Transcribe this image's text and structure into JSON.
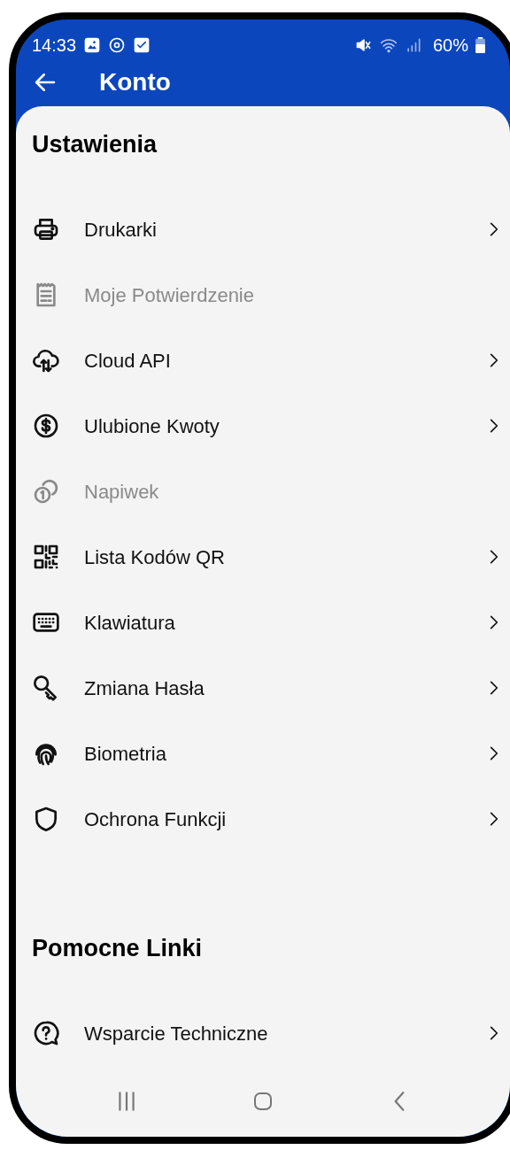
{
  "status_bar": {
    "time": "14:33",
    "battery": "60%"
  },
  "app_bar": {
    "title": "Konto"
  },
  "sections": [
    {
      "title": "Ustawienia",
      "items": [
        {
          "label": "Drukarki",
          "disabled": false
        },
        {
          "label": "Moje Potwierdzenie",
          "disabled": true
        },
        {
          "label": "Cloud API",
          "disabled": false
        },
        {
          "label": "Ulubione Kwoty",
          "disabled": false
        },
        {
          "label": "Napiwek",
          "disabled": true
        },
        {
          "label": "Lista Kodów QR",
          "disabled": false
        },
        {
          "label": "Klawiatura",
          "disabled": false
        },
        {
          "label": "Zmiana Hasła",
          "disabled": false
        },
        {
          "label": "Biometria",
          "disabled": false
        },
        {
          "label": "Ochrona Funkcji",
          "disabled": false
        }
      ]
    },
    {
      "title": "Pomocne Linki",
      "items": [
        {
          "label": "Wsparcie Techniczne",
          "disabled": false
        }
      ]
    }
  ]
}
